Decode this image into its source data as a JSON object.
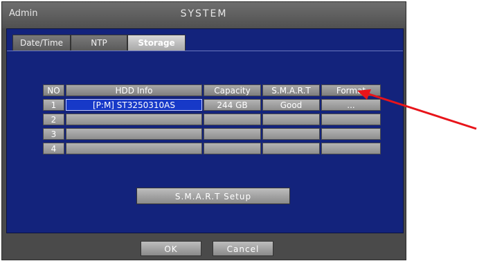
{
  "window": {
    "role": "Admin",
    "title": "SYSTEM"
  },
  "tabs": [
    {
      "label": "Date/Time"
    },
    {
      "label": "NTP"
    },
    {
      "label": "Storage"
    }
  ],
  "table": {
    "headers": [
      "NO",
      "HDD Info",
      "Capacity",
      "S.M.A.R.T",
      "Format"
    ],
    "rows": [
      {
        "no": "1",
        "hdd_info": "[P:M] ST3250310AS",
        "capacity": "244 GB",
        "smart": "Good",
        "format": "..."
      },
      {
        "no": "2",
        "hdd_info": "",
        "capacity": "",
        "smart": "",
        "format": ""
      },
      {
        "no": "3",
        "hdd_info": "",
        "capacity": "",
        "smart": "",
        "format": ""
      },
      {
        "no": "4",
        "hdd_info": "",
        "capacity": "",
        "smart": "",
        "format": ""
      }
    ]
  },
  "smart_setup_label": "S.M.A.R.T Setup",
  "footer": {
    "ok_label": "OK",
    "cancel_label": "Cancel"
  },
  "annotation": {
    "arrow_color": "#e8141a",
    "arrow_target": "Format"
  }
}
